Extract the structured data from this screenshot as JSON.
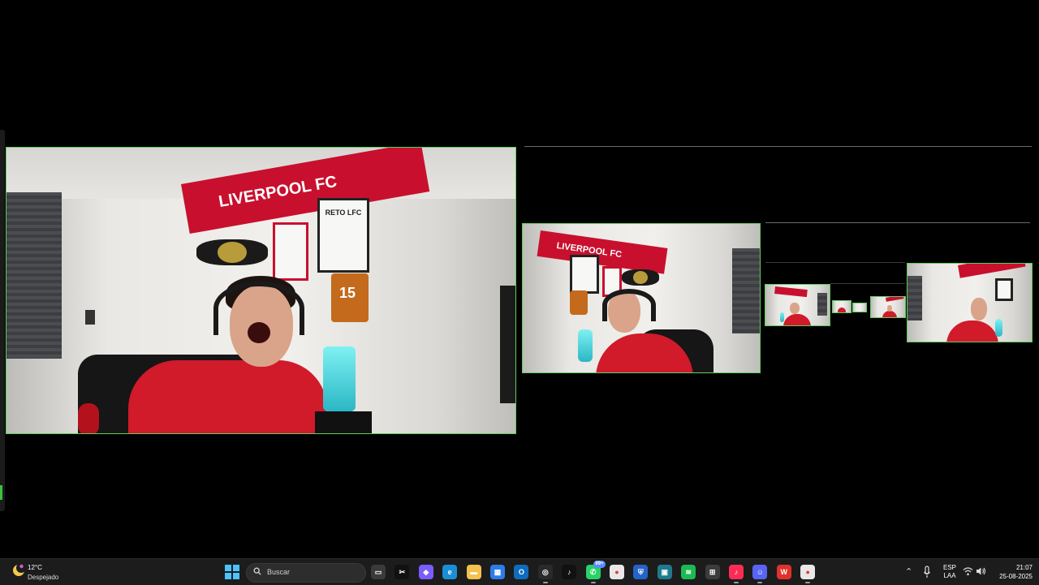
{
  "weather": {
    "temperature": "12°C",
    "condition": "Despejado",
    "icon": "weather-night-icon"
  },
  "taskbar": {
    "search_placeholder": "Buscar",
    "apps": [
      {
        "name": "task-view-icon",
        "color": "#3a3a3a"
      },
      {
        "name": "capcut-icon",
        "color": "#111111"
      },
      {
        "name": "copilot-icon",
        "color": "#7b5cff"
      },
      {
        "name": "edge-icon",
        "color": "#1b8fd6"
      },
      {
        "name": "file-explorer-icon",
        "color": "#f2c14e"
      },
      {
        "name": "microsoft-store-icon",
        "color": "#2b7de9"
      },
      {
        "name": "outlook-icon",
        "color": "#0f6cbd"
      },
      {
        "name": "obs-studio-icon",
        "color": "#2a2a2a"
      },
      {
        "name": "tiktok-icon",
        "color": "#111111"
      },
      {
        "name": "whatsapp-icon",
        "color": "#25d366"
      },
      {
        "name": "chrome-icon",
        "color": "#e8e8e8"
      },
      {
        "name": "windows-security-icon",
        "color": "#2563c9"
      },
      {
        "name": "photos-icon",
        "color": "#1f7a8c"
      },
      {
        "name": "spotify-icon",
        "color": "#1db954"
      },
      {
        "name": "calculator-icon",
        "color": "#3c3c3c"
      },
      {
        "name": "tiktok-live-studio-icon",
        "color": "#fe2c55"
      },
      {
        "name": "discord-icon",
        "color": "#5865f2"
      },
      {
        "name": "wps-office-icon",
        "color": "#e0312b"
      },
      {
        "name": "chrome-profile-icon",
        "color": "#e8e8e8"
      }
    ],
    "whatsapp_badge": "99+"
  },
  "tray": {
    "language_line1": "ESP",
    "language_line2": "LAA",
    "time": "21:07",
    "date": "25-08-2025"
  },
  "scene": {
    "banner_text": "LIVERPOOL FC",
    "poster_text": "RETO LFC",
    "sign_text": "15"
  },
  "colors": {
    "frame_border": "#5fcf5f",
    "jersey_red": "#d11a2a",
    "mic_cyan": "#5fd6de",
    "taskbar_bg": "#1c1c1c"
  }
}
